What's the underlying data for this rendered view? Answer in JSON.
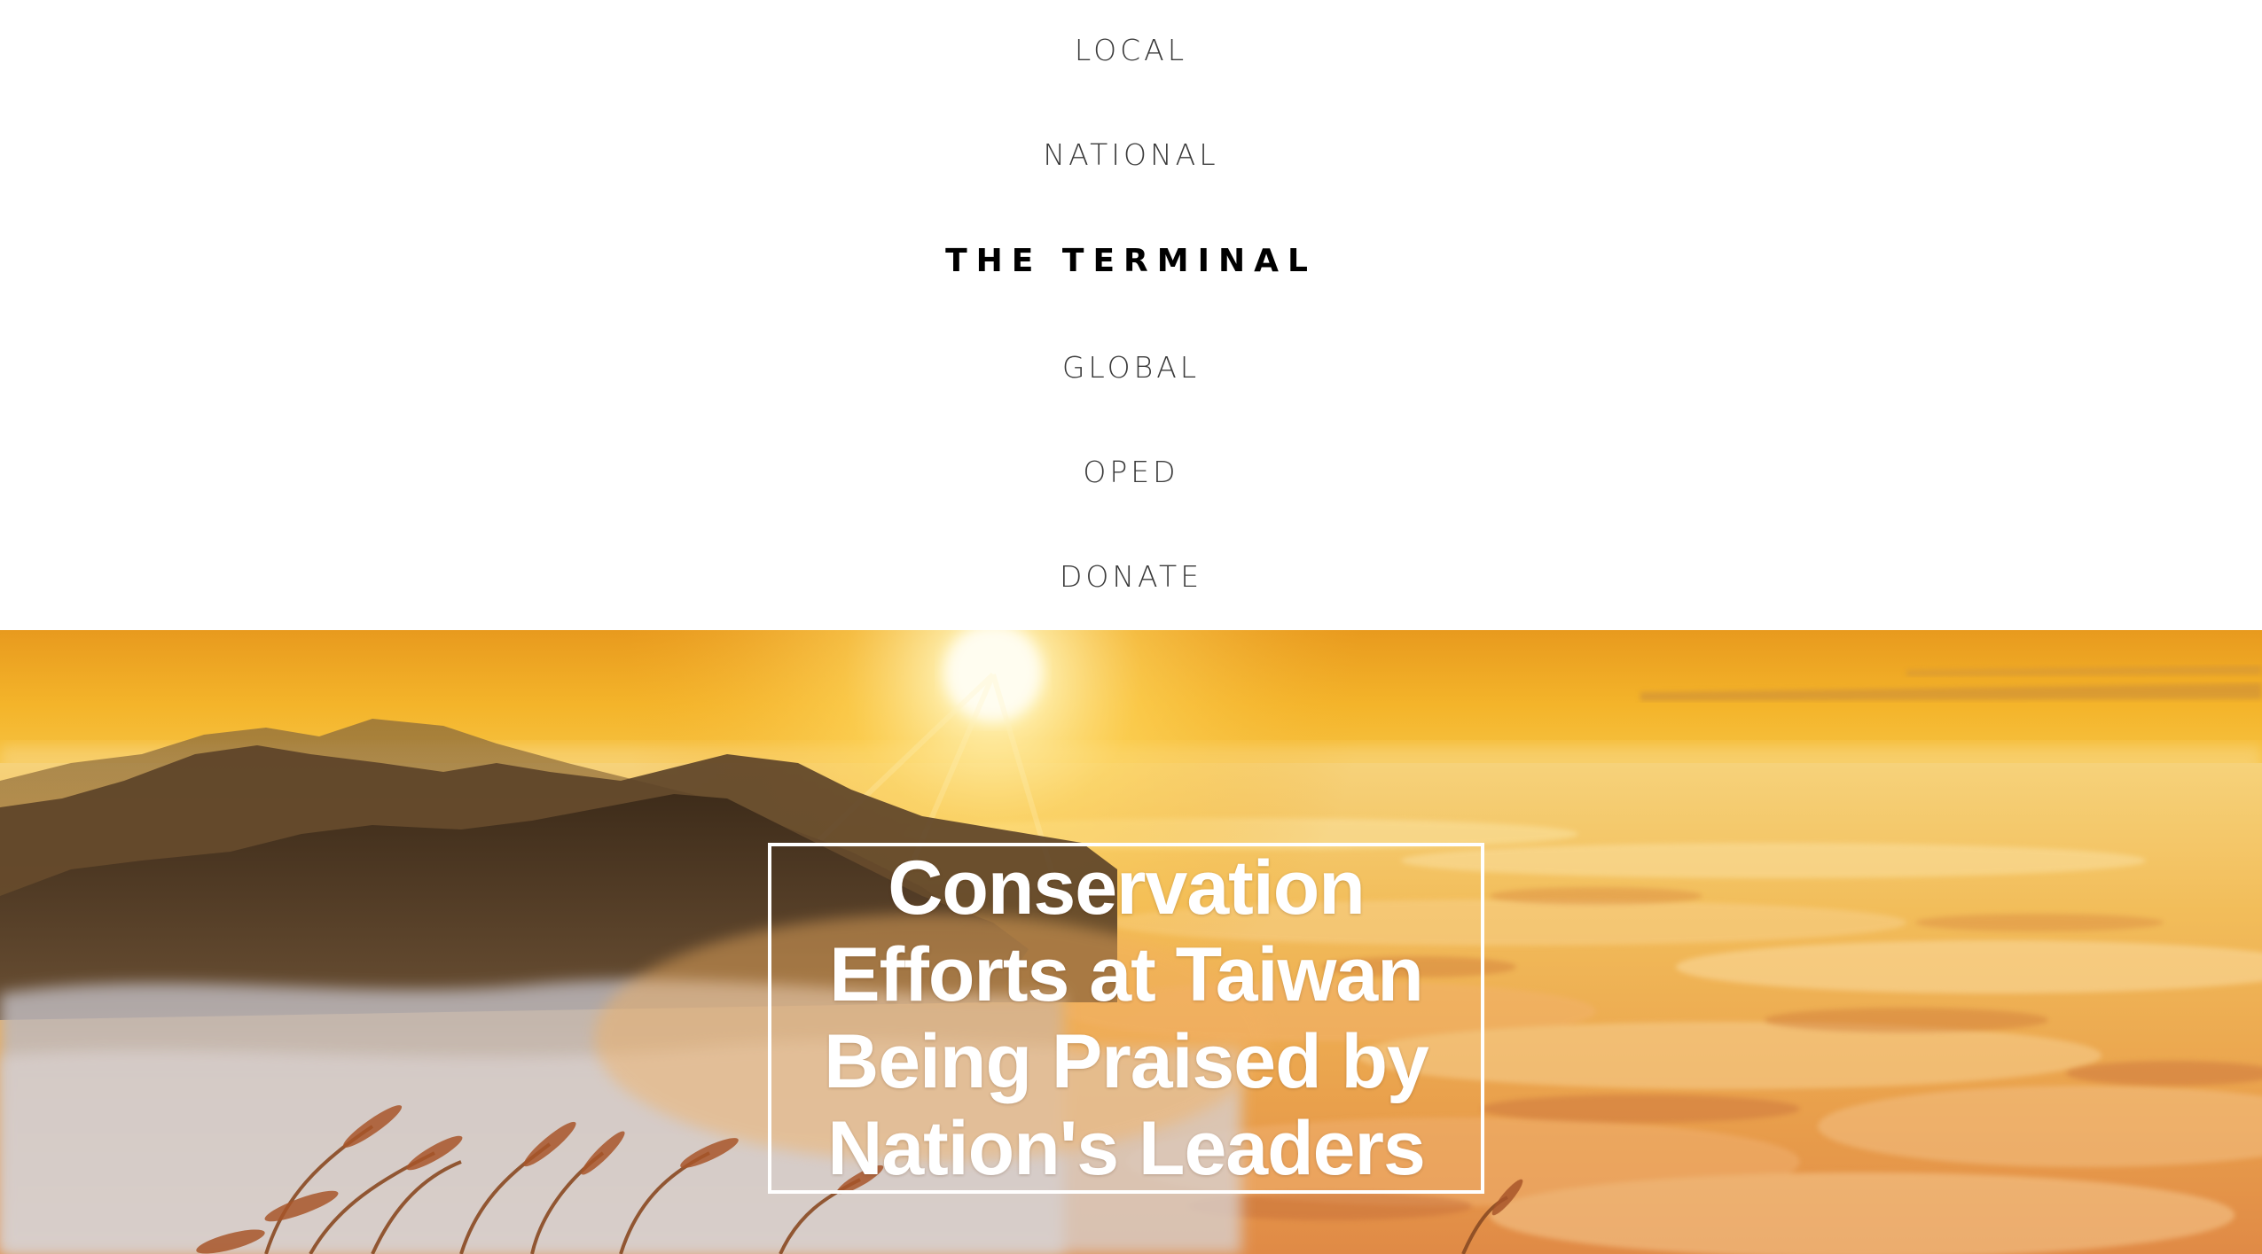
{
  "nav": {
    "items": [
      {
        "label": "LOCAL",
        "active": false
      },
      {
        "label": "NATIONAL",
        "active": false
      },
      {
        "label": "THE TERMINAL",
        "active": true
      },
      {
        "label": "GLOBAL",
        "active": false
      },
      {
        "label": "OPED",
        "active": false
      },
      {
        "label": "DONATE",
        "active": false
      }
    ]
  },
  "hero": {
    "headline": "Conservation Efforts at Taiwan Being Praised by Nation's Leaders",
    "image": "sunrise-sea-of-clouds-over-mountains"
  },
  "colors": {
    "nav_text": "#3a3a3a",
    "nav_active_text": "#000000",
    "sky_top": "#f2a21c",
    "sun": "#fff6c8",
    "clouds": "#f3c45a",
    "mountains": "#4a3420",
    "headline_text": "#ffffff"
  }
}
